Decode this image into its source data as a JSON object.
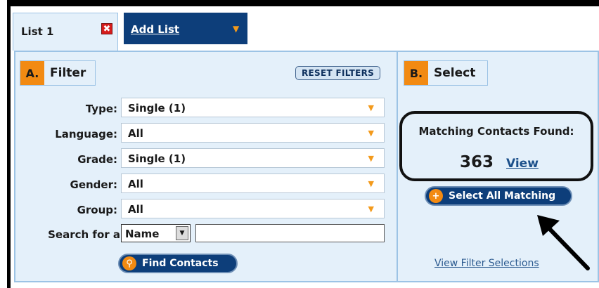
{
  "tabs": {
    "list1": {
      "label": "List 1",
      "close_icon": "✖"
    },
    "add_list": {
      "label": "Add List",
      "arrow": "▼"
    }
  },
  "filter": {
    "letter": "A.",
    "title": "Filter",
    "reset_label": "RESET FILTERS",
    "rows": [
      {
        "label": "Type:",
        "value": "Single (1)"
      },
      {
        "label": "Language:",
        "value": "All"
      },
      {
        "label": "Grade:",
        "value": "Single (1)"
      },
      {
        "label": "Gender:",
        "value": "All"
      },
      {
        "label": "Group:",
        "value": "All"
      }
    ],
    "search_label": "Search for a",
    "search_select_value": "Name",
    "search_input_value": "",
    "find_label": "Find Contacts"
  },
  "select": {
    "letter": "B.",
    "title": "Select",
    "matching_label": "Matching Contacts Found:",
    "matching_count": "363",
    "view_label": "View",
    "select_all_label": "Select All Matching",
    "view_filter_label": "View Filter Selections"
  },
  "colors": {
    "accent_orange": "#f28a12",
    "navy": "#0d3e7a",
    "panel_bg": "#e4f0fa",
    "panel_border": "#9cc3e5"
  },
  "icons": {
    "close": "close-icon",
    "dropdown": "dropdown-arrow-icon",
    "find": "magnifier-icon",
    "select_all": "plus-icon",
    "pointer": "arrow-icon"
  }
}
